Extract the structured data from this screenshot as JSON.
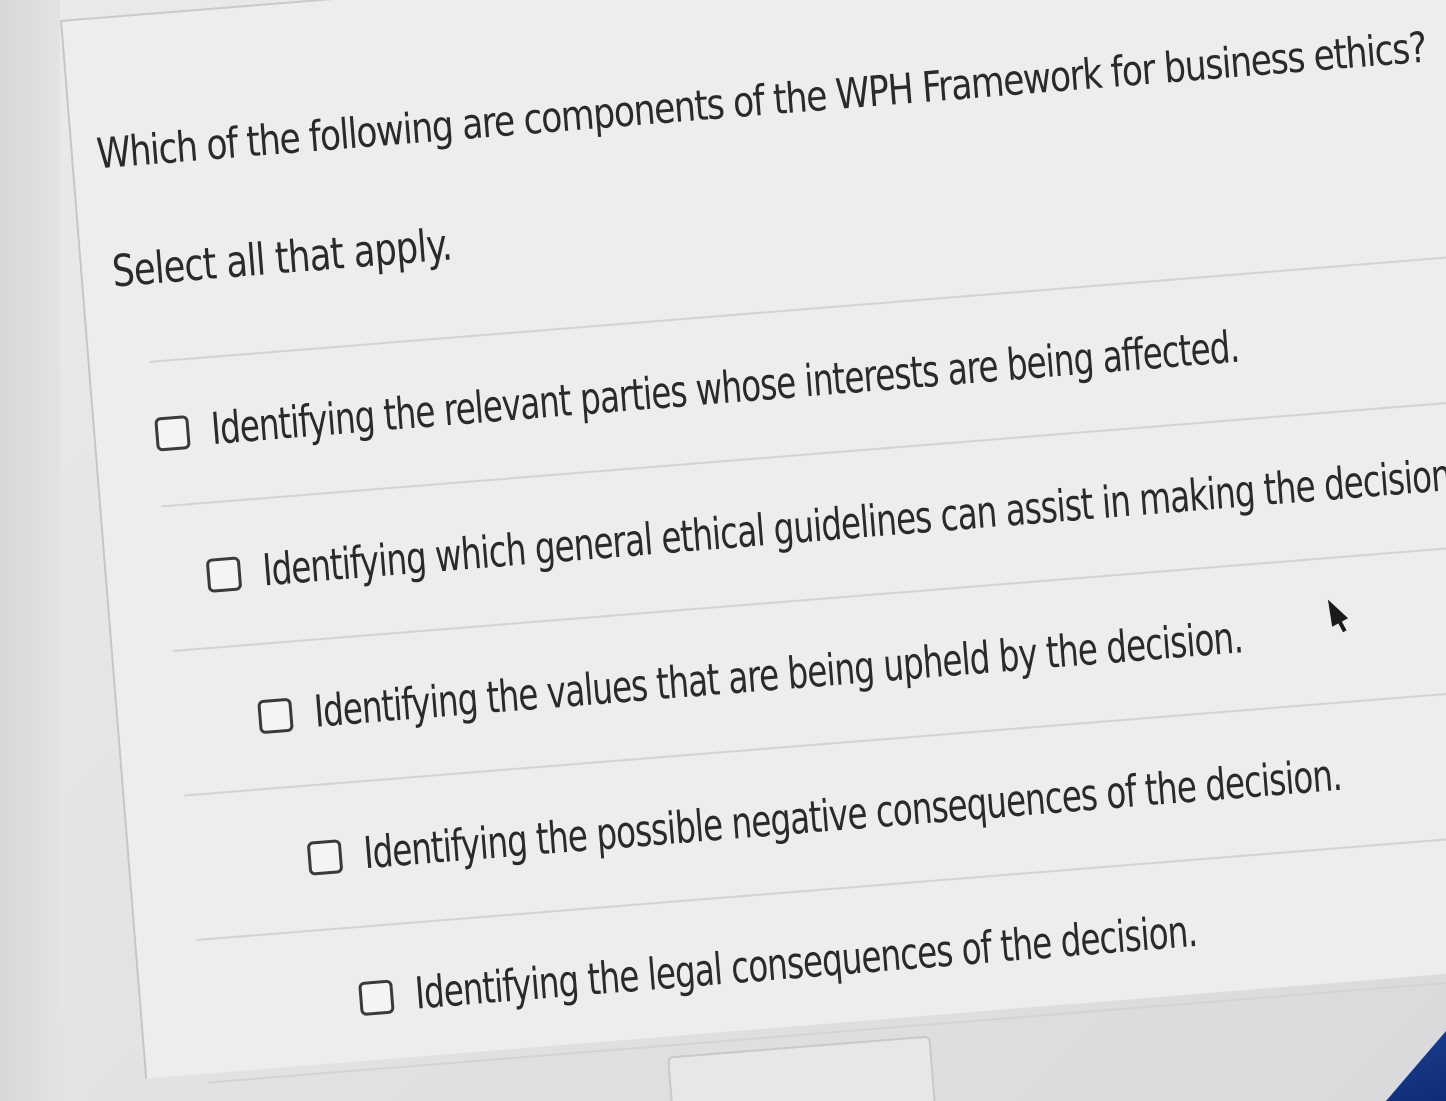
{
  "question": {
    "text": "Which of the following are components of the WPH Framework for business ethics?",
    "instruction": "Select all that apply."
  },
  "options": [
    {
      "label": "Identifying the relevant parties whose interests are being affected.",
      "checked": false
    },
    {
      "label": "Identifying which general ethical guidelines can assist in making the decision.",
      "checked": false
    },
    {
      "label": "Identifying the values that are being upheld by the decision.",
      "checked": false
    },
    {
      "label": "Identifying the possible negative consequences of the decision.",
      "checked": false
    },
    {
      "label": "Identifying the legal consequences of the decision.",
      "checked": false
    }
  ],
  "colors": {
    "text": "#2a2a2c",
    "card_background": "#eceded",
    "divider": "#d2d3d5",
    "checkbox_border": "#3a3a3c",
    "screen_corner": "#0e2c78"
  },
  "icons": {
    "cursor": "mouse-pointer-icon",
    "checkbox": "checkbox-unchecked-icon"
  }
}
